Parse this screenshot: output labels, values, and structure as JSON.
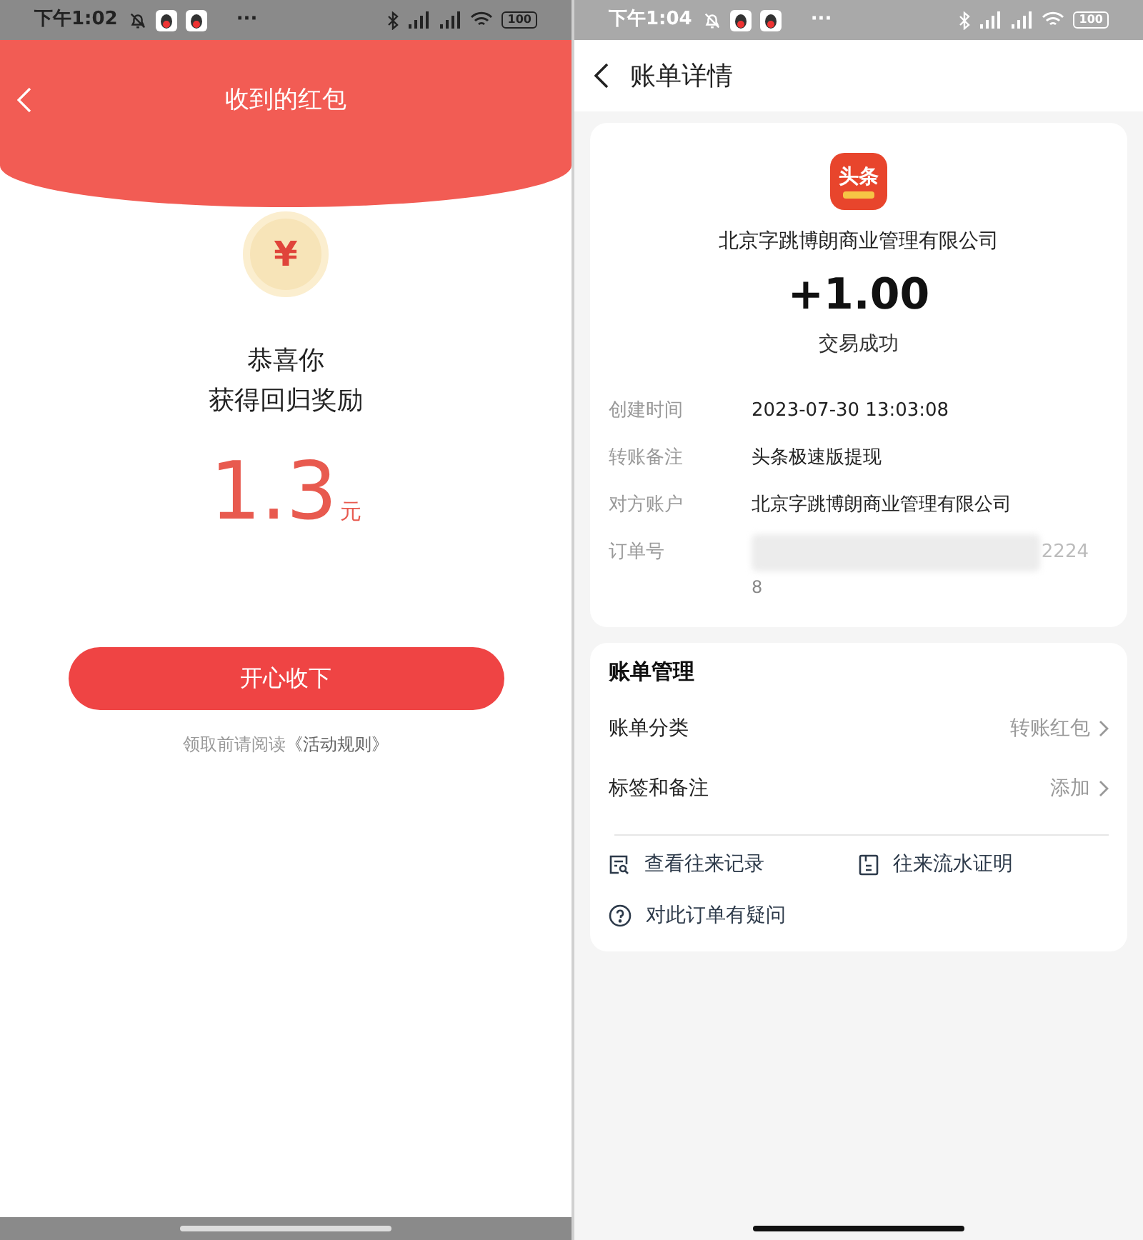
{
  "left_screen": {
    "status_bar": {
      "time": "下午1:02",
      "more": "···",
      "battery": "100"
    },
    "title": "收到的红包",
    "coin_symbol": "¥",
    "greeting": "恭喜你",
    "message": "获得回归奖励",
    "amount": "1.3",
    "unit": "元",
    "accept_button": "开心收下",
    "rules_prefix": "领取前请阅读",
    "rules_link": "《活动规则》"
  },
  "right_screen": {
    "status_bar": {
      "time": "下午1:04",
      "more": "···",
      "battery": "100"
    },
    "title": "账单详情",
    "logo_text": "头条",
    "payee": "北京字跳博朗商业管理有限公司",
    "amount": "+1.00",
    "status": "交易成功",
    "details": [
      {
        "label": "创建时间",
        "value": "2023-07-30 13:03:08"
      },
      {
        "label": "转账备注",
        "value": "头条极速版提现"
      },
      {
        "label": "对方账户",
        "value": "北京字跳博朗商业管理有限公司"
      }
    ],
    "order": {
      "label": "订单号",
      "value_end": "2224",
      "value_wrap": "8"
    },
    "management": {
      "title": "账单管理",
      "rows": [
        {
          "label": "账单分类",
          "value": "转账红包"
        },
        {
          "label": "标签和备注",
          "value": "添加"
        }
      ],
      "links": [
        {
          "kind": "records",
          "label": "查看往来记录"
        },
        {
          "kind": "certificate",
          "label": "往来流水证明"
        },
        {
          "kind": "question",
          "label": "对此订单有疑问"
        }
      ]
    }
  }
}
